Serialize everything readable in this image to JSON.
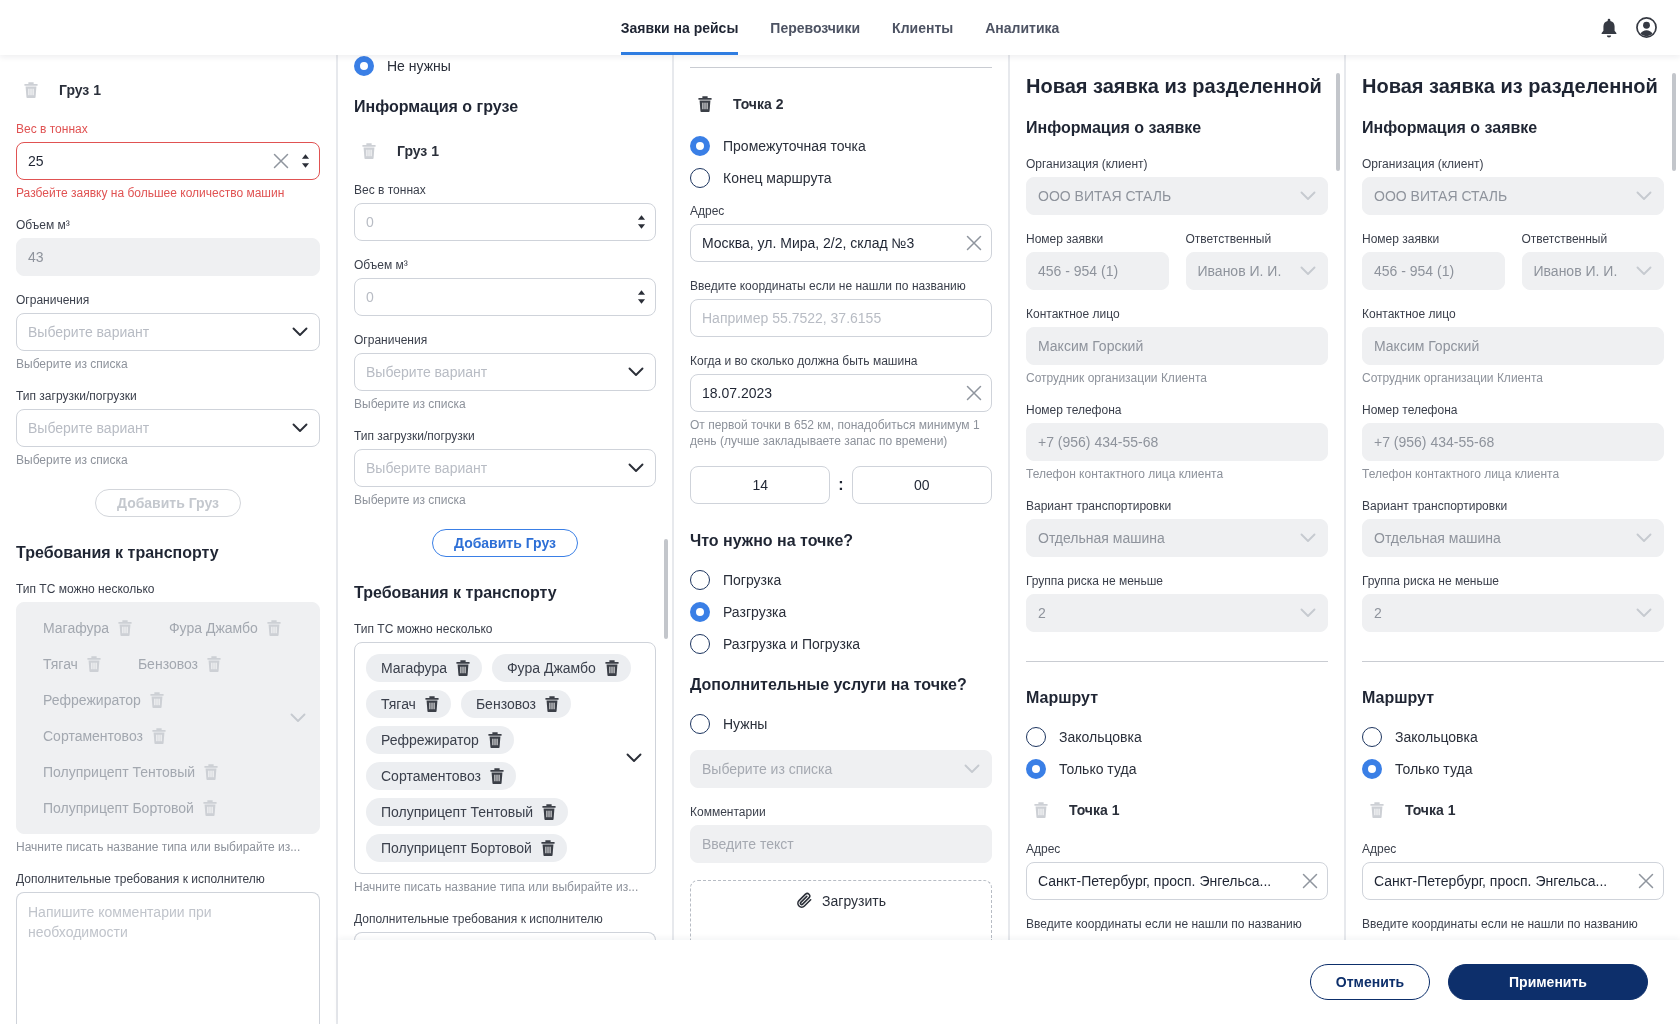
{
  "nav": {
    "tabs": [
      {
        "label": "Заявки на рейсы",
        "selected": true
      },
      {
        "label": "Перевозчики",
        "selected": false
      },
      {
        "label": "Клиенты",
        "selected": false
      },
      {
        "label": "Аналитика",
        "selected": false
      }
    ]
  },
  "panels": [
    {
      "blocks": [
        {
          "kind": "item",
          "label": "Груз 1",
          "disabled": true
        },
        {
          "kind": "number",
          "label": "Вес в тоннах",
          "value": "25",
          "clearable": true,
          "error": "Разбейте заявку на большее количество машин"
        },
        {
          "kind": "text",
          "label": "Объем м³",
          "value": "43",
          "disabled": true
        },
        {
          "kind": "select",
          "label": "Ограничения",
          "placeholder": "Выберите вариант",
          "hint": "Выберите из списка"
        },
        {
          "kind": "select",
          "label": "Тип загрузки/погрузки",
          "placeholder": "Выберите вариант",
          "hint": "Выберите из списка"
        },
        {
          "kind": "button",
          "label": "Добавить Груз",
          "disabled": true
        },
        {
          "kind": "heading",
          "text": "Требования к транспорту"
        },
        {
          "kind": "tags",
          "label": "Тип ТС можно несколько",
          "disabled": true,
          "tags": [
            "Магафура",
            "Фура Джамбо",
            "Тягач",
            "Бензовоз",
            "Рефрежиратор",
            "Сортаментовоз",
            "Полуприцепт Тентовый",
            "Полуприцепт Бортовой"
          ],
          "hint": "Начните писать название типа или выбирайте из..."
        },
        {
          "kind": "textarea",
          "label": "Дополнительные требования к исполнителю",
          "placeholder": "Напишите комментарии при необходимости"
        }
      ]
    },
    {
      "blocks": [
        {
          "kind": "radio_group",
          "options": [
            {
              "label": "Не нужны",
              "selected": true
            }
          ]
        },
        {
          "kind": "heading",
          "text": "Информация о грузе"
        },
        {
          "kind": "item",
          "label": "Груз 1",
          "disabled": true
        },
        {
          "kind": "number",
          "label": "Вес в тоннах",
          "placeholder": "0"
        },
        {
          "kind": "number",
          "label": "Объем м³",
          "placeholder": "0"
        },
        {
          "kind": "select",
          "label": "Ограничения",
          "placeholder": "Выберите вариант",
          "hint": "Выберите из списка"
        },
        {
          "kind": "select",
          "label": "Тип загрузки/погрузки",
          "placeholder": "Выберите вариант",
          "hint": "Выберите из списка"
        },
        {
          "kind": "button",
          "label": "Добавить Груз",
          "disabled": false
        },
        {
          "kind": "heading",
          "text": "Требования к транспорту"
        },
        {
          "kind": "tags",
          "label": "Тип ТС можно несколько",
          "disabled": false,
          "tags": [
            "Магафура",
            "Фура Джамбо",
            "Тягач",
            "Бензовоз",
            "Рефрежиратор",
            "Сортаментовоз",
            "Полуприцепт Тентовый",
            "Полуприцепт Бортовой"
          ],
          "hint": "Начните писать название типа или выбирайте из..."
        },
        {
          "kind": "textarea",
          "label": "Дополнительные требования к исполнителю"
        }
      ]
    },
    {
      "blocks": [
        {
          "kind": "divider"
        },
        {
          "kind": "item",
          "label": "Точка 2",
          "disabled": false
        },
        {
          "kind": "radio_group",
          "options": [
            {
              "label": "Промежуточная точка",
              "selected": true
            },
            {
              "label": "Конец маршрута",
              "selected": false
            }
          ]
        },
        {
          "kind": "text",
          "label": "Адрес",
          "value": "Москва, ул. Мира, 2/2, склад №3",
          "clearable": true
        },
        {
          "kind": "text",
          "label": "Введите координаты если не нашли по названию",
          "placeholder": "Например 55.7522, 37.6155"
        },
        {
          "kind": "text",
          "label": "Когда и во сколько должна быть машина",
          "value": "18.07.2023",
          "clearable": true,
          "hint": "От первой точки в 652 км, понадобиться минимум 1 день (лучше закладываете запас по времени)"
        },
        {
          "kind": "time",
          "hours": "14",
          "separator": ":",
          "minutes": "00"
        },
        {
          "kind": "heading",
          "text": "Что нужно на точке?"
        },
        {
          "kind": "radio_group",
          "options": [
            {
              "label": "Погрузка",
              "selected": false
            },
            {
              "label": "Разгрузка",
              "selected": true
            },
            {
              "label": "Разгрузка и Погрузка",
              "selected": false
            }
          ]
        },
        {
          "kind": "heading",
          "text": "Дополнительные услуги на точке?"
        },
        {
          "kind": "radio_group",
          "options": [
            {
              "label": "Нужны",
              "selected": false
            }
          ]
        },
        {
          "kind": "select",
          "placeholder": "Выберите из списка",
          "disabled": true
        },
        {
          "kind": "text",
          "label": "Комментарии",
          "placeholder": "Введите текст",
          "disabled": true
        },
        {
          "kind": "upload",
          "label": "Загрузить"
        }
      ]
    },
    {
      "blocks": [
        {
          "kind": "title",
          "text": "Новая заявка из разделенной"
        },
        {
          "kind": "heading",
          "text": "Информация о заявке"
        },
        {
          "kind": "select",
          "label": "Организация (клиент)",
          "value": "ООО ВИТАЯ СТАЛЬ",
          "disabled": true
        },
        {
          "kind": "field_row",
          "fields": [
            {
              "kind": "text",
              "label": "Номер заявки",
              "value": "456 - 954 (1)",
              "disabled": true
            },
            {
              "kind": "select",
              "label": "Ответственный",
              "value": "Иванов И. И.",
              "disabled": true
            }
          ]
        },
        {
          "kind": "text",
          "label": "Контактное лицо",
          "value": "Максим Горский",
          "disabled": true,
          "hint": "Сотрудник организации Клиента"
        },
        {
          "kind": "text",
          "label": "Номер телефона",
          "value": "+7 (956) 434-55-68",
          "disabled": true,
          "hint": "Телефон контактного лица клиента"
        },
        {
          "kind": "select",
          "label": "Вариант транспортировки",
          "value": "Отдельная машина",
          "disabled": true
        },
        {
          "kind": "select",
          "label": "Группа риска не меньше",
          "value": "2",
          "disabled": true
        },
        {
          "kind": "divider"
        },
        {
          "kind": "heading",
          "text": "Маршрут"
        },
        {
          "kind": "radio_group",
          "options": [
            {
              "label": "Закольцовка",
              "selected": false
            },
            {
              "label": "Только туда",
              "selected": true
            }
          ]
        },
        {
          "kind": "item",
          "label": "Точка 1",
          "disabled": true
        },
        {
          "kind": "text",
          "label": "Адрес",
          "value": "Санкт-Петербург, просп. Энгельса...",
          "clearable": true
        },
        {
          "kind": "label",
          "text": "Введите координаты если не нашли по названию"
        }
      ]
    },
    {
      "blocks": [
        {
          "kind": "title",
          "text": "Новая заявка из разделенной"
        },
        {
          "kind": "heading",
          "text": "Информация о заявке"
        },
        {
          "kind": "select",
          "label": "Организация (клиент)",
          "value": "ООО ВИТАЯ СТАЛЬ",
          "disabled": true
        },
        {
          "kind": "field_row",
          "fields": [
            {
              "kind": "text",
              "label": "Номер заявки",
              "value": "456 - 954 (1)",
              "disabled": true
            },
            {
              "kind": "select",
              "label": "Ответственный",
              "value": "Иванов И. И.",
              "disabled": true
            }
          ]
        },
        {
          "kind": "text",
          "label": "Контактное лицо",
          "value": "Максим Горский",
          "disabled": true,
          "hint": "Сотрудник организации Клиента"
        },
        {
          "kind": "text",
          "label": "Номер телефона",
          "value": "+7 (956) 434-55-68",
          "disabled": true,
          "hint": "Телефон контактного лица клиента"
        },
        {
          "kind": "select",
          "label": "Вариант транспортировки",
          "value": "Отдельная машина",
          "disabled": true
        },
        {
          "kind": "select",
          "label": "Группа риска не меньше",
          "value": "2",
          "disabled": true
        },
        {
          "kind": "divider"
        },
        {
          "kind": "heading",
          "text": "Маршрут"
        },
        {
          "kind": "radio_group",
          "options": [
            {
              "label": "Закольцовка",
              "selected": false
            },
            {
              "label": "Только туда",
              "selected": true
            }
          ]
        },
        {
          "kind": "item",
          "label": "Точка 1",
          "disabled": true
        },
        {
          "kind": "text",
          "label": "Адрес",
          "value": "Санкт-Петербург, просп. Энгельса...",
          "clearable": true
        },
        {
          "kind": "label",
          "text": "Введите координаты если не нашли по названию"
        }
      ]
    }
  ],
  "footer": {
    "buttons": [
      {
        "label": "Отменить",
        "kind": "secondary"
      },
      {
        "label": "Применить",
        "kind": "primary"
      }
    ]
  }
}
